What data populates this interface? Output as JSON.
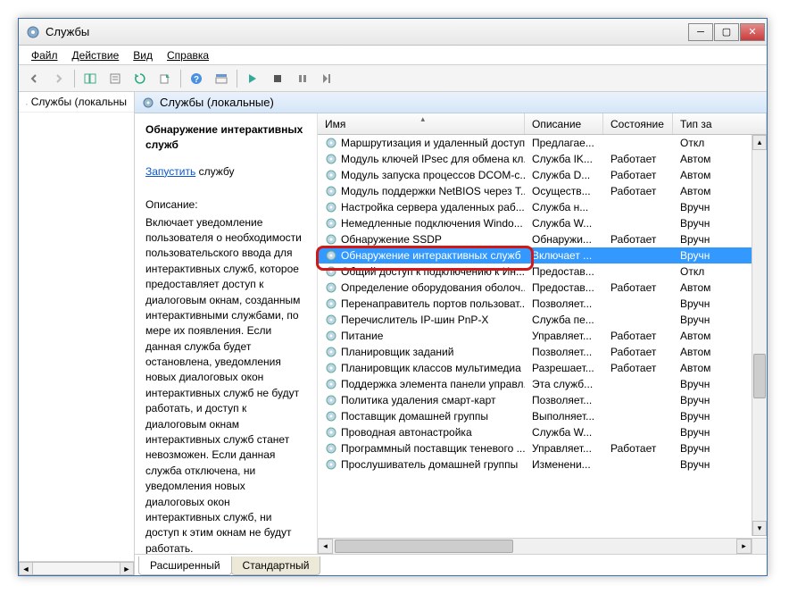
{
  "window": {
    "title": "Службы"
  },
  "menu": {
    "file": "Файл",
    "action": "Действие",
    "view": "Вид",
    "help": "Справка"
  },
  "nav": {
    "item": "Службы (локальны"
  },
  "main_header": "Службы (локальные)",
  "detail": {
    "name": "Обнаружение интерактивных служб",
    "start_link": "Запустить",
    "start_suffix": " службу",
    "desc_label": "Описание:",
    "desc_text": "Включает уведомление пользователя о необходимости пользовательского ввода для интерактивных служб, которое предоставляет доступ к диалоговым окнам, созданным интерактивными службами, по мере их появления. Если данная служба будет остановлена, уведомления новых диалоговых окон интерактивных служб не будут работать, и доступ к диалоговым окнам интерактивных служб станет невозможен. Если данная служба отключена, ни уведомления новых диалоговых окон интерактивных служб, ни доступ к этим окнам не будут работать."
  },
  "columns": {
    "name": "Имя",
    "desc": "Описание",
    "state": "Состояние",
    "type": "Тип за"
  },
  "services": [
    {
      "name": "Маршрутизация и удаленный доступ",
      "desc": "Предлагае...",
      "state": "",
      "type": "Откл"
    },
    {
      "name": "Модуль ключей IPsec для обмена кл...",
      "desc": "Служба IK...",
      "state": "Работает",
      "type": "Автом"
    },
    {
      "name": "Модуль запуска процессов DCOM-с...",
      "desc": "Служба D...",
      "state": "Работает",
      "type": "Автом"
    },
    {
      "name": "Модуль поддержки NetBIOS через T...",
      "desc": "Осуществ...",
      "state": "Работает",
      "type": "Автом"
    },
    {
      "name": "Настройка сервера удаленных раб...",
      "desc": "Служба н...",
      "state": "",
      "type": "Вручн"
    },
    {
      "name": "Немедленные подключения Windo...",
      "desc": "Служба W...",
      "state": "",
      "type": "Вручн"
    },
    {
      "name": "Обнаружение SSDP",
      "desc": "Обнаружи...",
      "state": "Работает",
      "type": "Вручн"
    },
    {
      "name": "Обнаружение интерактивных служб",
      "desc": "Включает ...",
      "state": "",
      "type": "Вручн",
      "selected": true
    },
    {
      "name": "Общий доступ к подключению к Ин...",
      "desc": "Предостав...",
      "state": "",
      "type": "Откл"
    },
    {
      "name": "Определение оборудования оболоч...",
      "desc": "Предостав...",
      "state": "Работает",
      "type": "Автом"
    },
    {
      "name": "Перенаправитель портов пользоват...",
      "desc": "Позволяет...",
      "state": "",
      "type": "Вручн"
    },
    {
      "name": "Перечислитель IP-шин PnP-X",
      "desc": "Служба пе...",
      "state": "",
      "type": "Вручн"
    },
    {
      "name": "Питание",
      "desc": "Управляет...",
      "state": "Работает",
      "type": "Автом"
    },
    {
      "name": "Планировщик заданий",
      "desc": "Позволяет...",
      "state": "Работает",
      "type": "Автом"
    },
    {
      "name": "Планировщик классов мультимедиа",
      "desc": "Разрешает...",
      "state": "Работает",
      "type": "Автом"
    },
    {
      "name": "Поддержка элемента панели управл...",
      "desc": "Эта служб...",
      "state": "",
      "type": "Вручн"
    },
    {
      "name": "Политика удаления смарт-карт",
      "desc": "Позволяет...",
      "state": "",
      "type": "Вручн"
    },
    {
      "name": "Поставщик домашней группы",
      "desc": "Выполняет...",
      "state": "",
      "type": "Вручн"
    },
    {
      "name": "Проводная автонастройка",
      "desc": "Служба W...",
      "state": "",
      "type": "Вручн"
    },
    {
      "name": "Программный поставщик теневого ...",
      "desc": "Управляет...",
      "state": "Работает",
      "type": "Вручн"
    },
    {
      "name": "Прослушиватель домашней группы",
      "desc": "Изменени...",
      "state": "",
      "type": "Вручн"
    }
  ],
  "tabs": {
    "extended": "Расширенный",
    "standard": "Стандартный"
  }
}
